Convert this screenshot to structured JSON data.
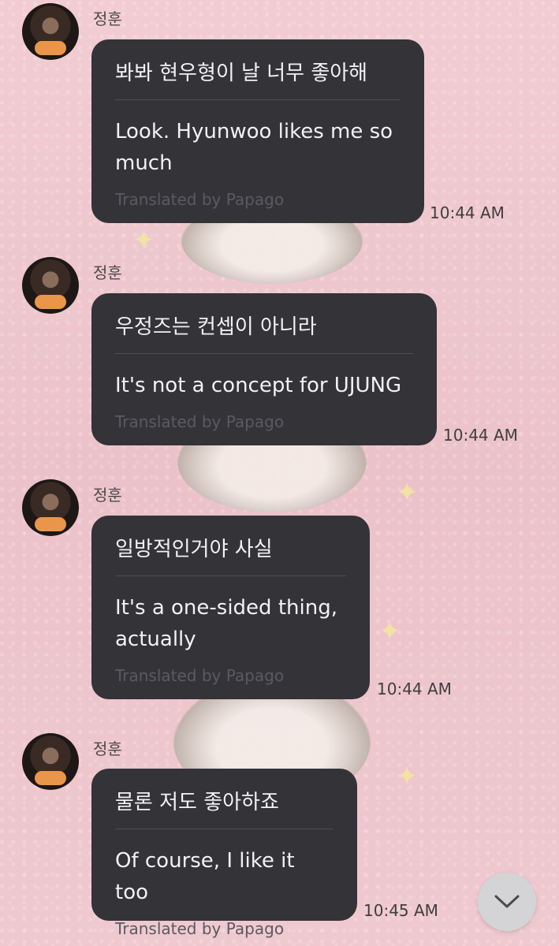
{
  "messages": [
    {
      "sender": "정훈",
      "korean": "봐봐 현우형이 날 너무 좋아해",
      "english": "Look. Hyunwoo likes me so much",
      "translated_by": "Translated by Papago",
      "time": "10:44 AM"
    },
    {
      "sender": "정훈",
      "korean": "우정즈는 컨셉이 아니라",
      "english": "It's not a concept for UJUNG",
      "translated_by": "Translated by Papago",
      "time": "10:44 AM"
    },
    {
      "sender": "정훈",
      "korean": "일방적인거야 사실",
      "english": "It's a one-sided thing, actually",
      "translated_by": "Translated by Papago",
      "time": "10:44 AM"
    },
    {
      "sender": "정훈",
      "korean": "물론 저도 좋아하죠",
      "english": "Of course, I like it too",
      "translated_by": "Translated by Papago",
      "time": "10:45 AM"
    }
  ],
  "scroll_button": {
    "icon": "chevron-down-icon"
  }
}
